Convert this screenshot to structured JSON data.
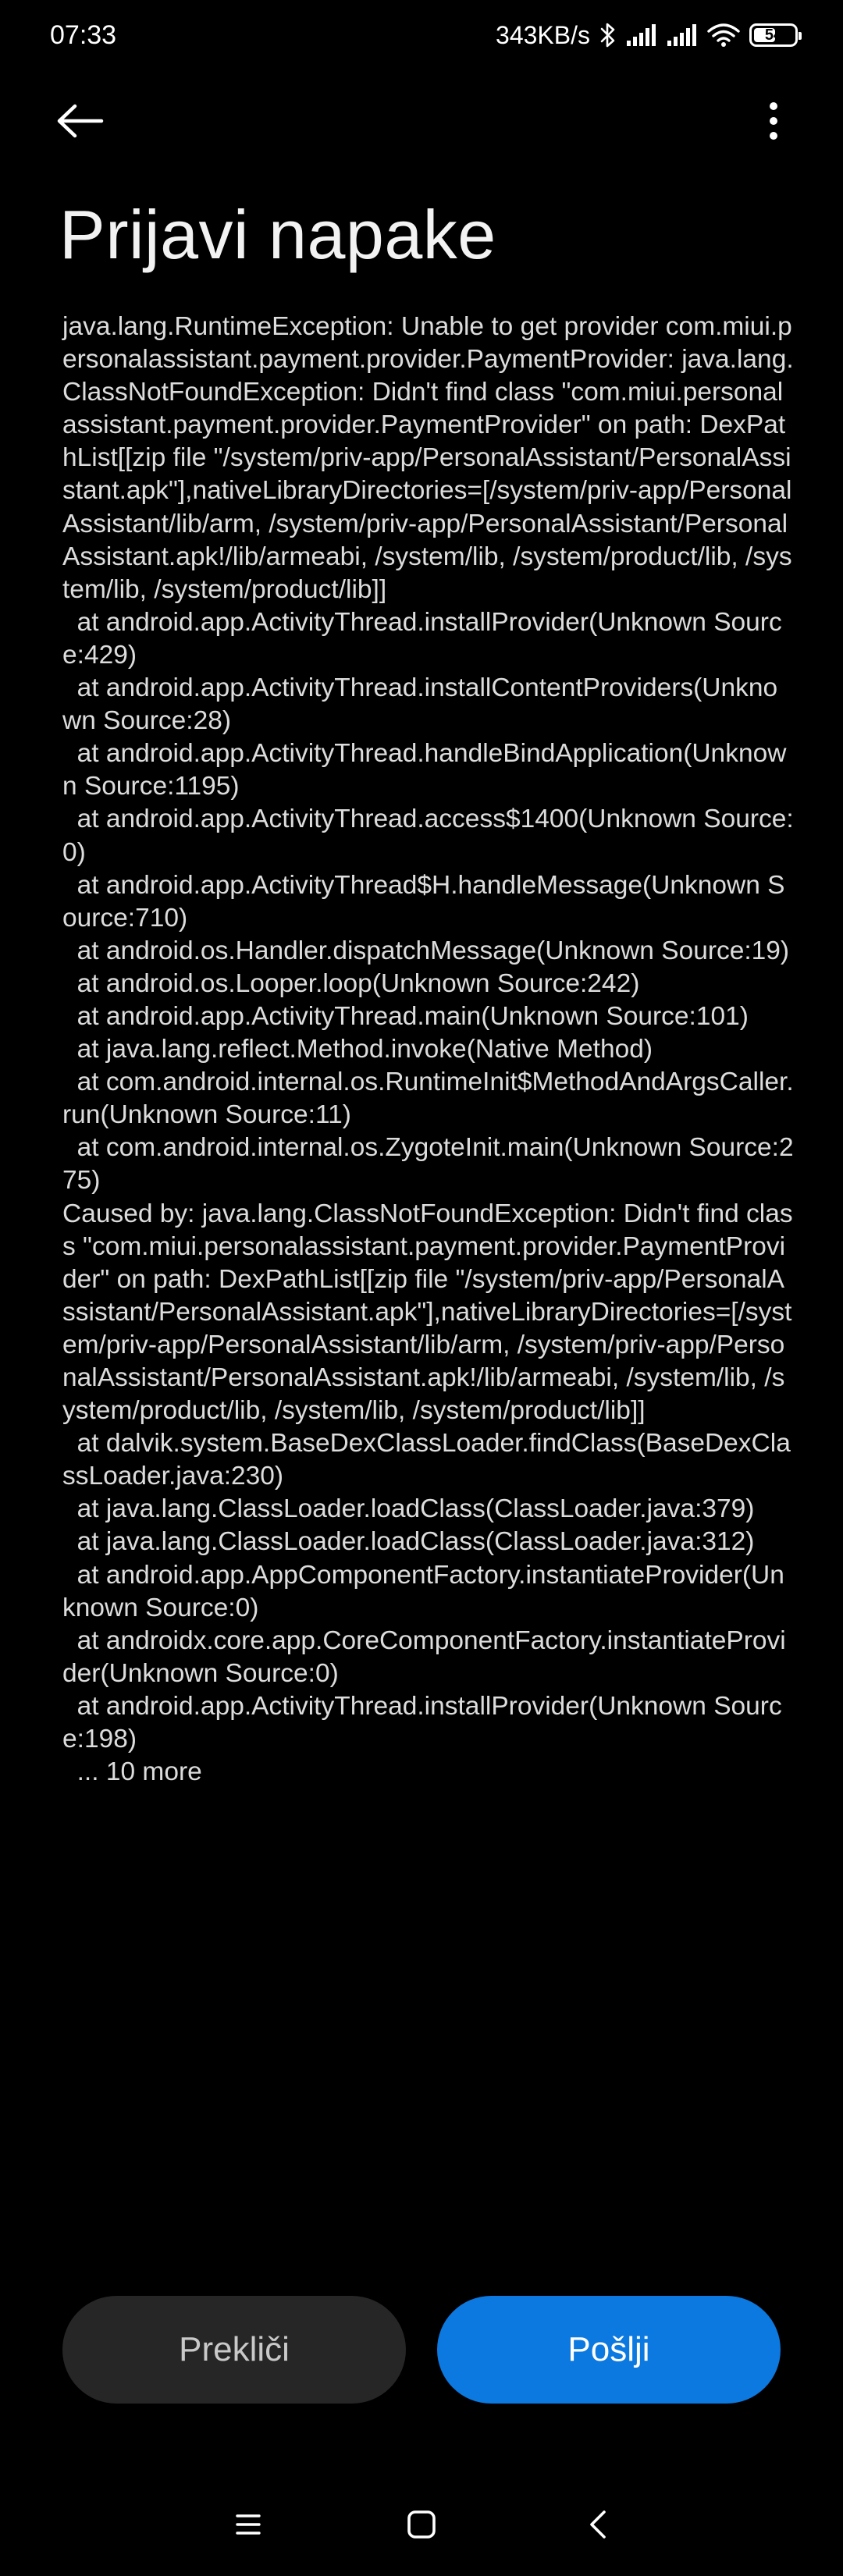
{
  "status_bar": {
    "time": "07:33",
    "net_speed": "343KB/s",
    "battery_level": "54",
    "battery_fraction": 0.54,
    "icons": [
      "bluetooth-icon",
      "signal-icon",
      "signal-icon",
      "wifi-icon",
      "battery-icon"
    ]
  },
  "app_bar": {
    "back_icon": "arrow-left-icon",
    "more_icon": "more-vertical-icon"
  },
  "page": {
    "title": "Prijavi napake",
    "log": "java.lang.RuntimeException: Unable to get provider com.miui.personalassistant.payment.provider.PaymentProvider: java.lang.ClassNotFoundException: Didn't find class \"com.miui.personalassistant.payment.provider.PaymentProvider\" on path: DexPathList[[zip file \"/system/priv-app/PersonalAssistant/PersonalAssistant.apk\"],nativeLibraryDirectories=[/system/priv-app/PersonalAssistant/lib/arm, /system/priv-app/PersonalAssistant/PersonalAssistant.apk!/lib/armeabi, /system/lib, /system/product/lib, /system/lib, /system/product/lib]]\n  at android.app.ActivityThread.installProvider(Unknown Source:429)\n  at android.app.ActivityThread.installContentProviders(Unknown Source:28)\n  at android.app.ActivityThread.handleBindApplication(Unknown Source:1195)\n  at android.app.ActivityThread.access$1400(Unknown Source:0)\n  at android.app.ActivityThread$H.handleMessage(Unknown Source:710)\n  at android.os.Handler.dispatchMessage(Unknown Source:19)\n  at android.os.Looper.loop(Unknown Source:242)\n  at android.app.ActivityThread.main(Unknown Source:101)\n  at java.lang.reflect.Method.invoke(Native Method)\n  at com.android.internal.os.RuntimeInit$MethodAndArgsCaller.run(Unknown Source:11)\n  at com.android.internal.os.ZygoteInit.main(Unknown Source:275)\nCaused by: java.lang.ClassNotFoundException: Didn't find class \"com.miui.personalassistant.payment.provider.PaymentProvider\" on path: DexPathList[[zip file \"/system/priv-app/PersonalAssistant/PersonalAssistant.apk\"],nativeLibraryDirectories=[/system/priv-app/PersonalAssistant/lib/arm, /system/priv-app/PersonalAssistant/PersonalAssistant.apk!/lib/armeabi, /system/lib, /system/product/lib, /system/lib, /system/product/lib]]\n  at dalvik.system.BaseDexClassLoader.findClass(BaseDexClassLoader.java:230)\n  at java.lang.ClassLoader.loadClass(ClassLoader.java:379)\n  at java.lang.ClassLoader.loadClass(ClassLoader.java:312)\n  at android.app.AppComponentFactory.instantiateProvider(Unknown Source:0)\n  at androidx.core.app.CoreComponentFactory.instantiateProvider(Unknown Source:0)\n  at android.app.ActivityThread.installProvider(Unknown Source:198)\n  ... 10 more"
  },
  "actions": {
    "cancel_label": "Prekliči",
    "send_label": "Pošlji"
  },
  "colors": {
    "background": "#000000",
    "primary_button": "#0c79e0",
    "secondary_button": "#262626"
  },
  "nav_bar": {
    "icons": [
      "menu-icon",
      "home-icon",
      "back-icon"
    ]
  }
}
